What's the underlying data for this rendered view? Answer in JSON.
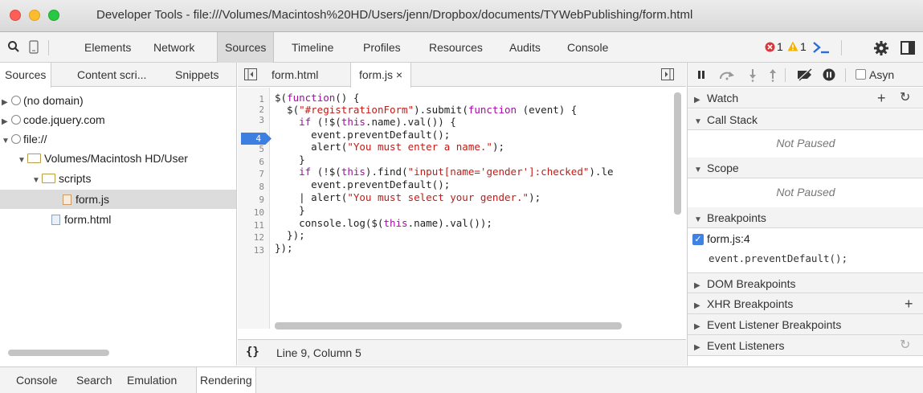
{
  "window": {
    "title": "Developer Tools - file:///Volumes/Macintosh%20HD/Users/jenn/Dropbox/documents/TYWebPublishing/form.html"
  },
  "toolbar": {
    "tabs": [
      "Elements",
      "Network",
      "Sources",
      "Timeline",
      "Profiles",
      "Resources",
      "Audits",
      "Console"
    ],
    "selected_tab": "Sources",
    "error_count": "1",
    "warning_count": "1"
  },
  "navigator": {
    "tabs": [
      "Sources",
      "Content scri...",
      "Snippets"
    ],
    "tree": [
      {
        "label": "(no domain)"
      },
      {
        "label": "code.jquery.com"
      },
      {
        "label": "file://"
      },
      {
        "label": "Volumes/Macintosh HD/User"
      },
      {
        "label": "scripts"
      },
      {
        "label": "form.js"
      },
      {
        "label": "form.html"
      }
    ]
  },
  "editor": {
    "tabs": [
      {
        "label": "form.html"
      },
      {
        "label": "form.js"
      }
    ],
    "close_glyph": "×",
    "line_numbers": [
      "1",
      "2",
      "3",
      "4",
      "5",
      "6",
      "7",
      "8",
      "9",
      "10",
      "11",
      "12",
      "13"
    ],
    "breakpoint_line": "4",
    "status": "Line 9, Column 5",
    "format_glyph": "{}"
  },
  "sidebar": {
    "async_label": "Asyn",
    "panes": {
      "watch": "Watch",
      "call_stack": "Call Stack",
      "call_stack_status": "Not Paused",
      "scope": "Scope",
      "scope_status": "Not Paused",
      "breakpoints": "Breakpoints",
      "breakpoint_file": "form.js:4",
      "breakpoint_code": "event.preventDefault();",
      "dom_breakpoints": "DOM Breakpoints",
      "xhr_breakpoints": "XHR Breakpoints",
      "event_listener_breakpoints": "Event Listener Breakpoints",
      "event_listeners": "Event Listeners"
    }
  },
  "drawer": {
    "tabs": [
      "Console",
      "Search",
      "Emulation",
      "Rendering"
    ],
    "selected_tab": "Rendering"
  },
  "colors": {
    "close_light": "#fc5f57",
    "minimize_light": "#fdbc2e",
    "zoom_light": "#28c840",
    "breakpoint_marker": "#3d7fe0",
    "keyword": "#a50aa5",
    "string": "#c41a16"
  },
  "icons": [
    "search-icon",
    "device-mode-icon",
    "error-icon",
    "warning-icon",
    "console-prompt-icon",
    "gear-icon",
    "dock-icon",
    "toggle-navigator-icon",
    "toggle-debugger-icon",
    "pause-icon",
    "step-over-icon",
    "step-into-icon",
    "step-out-icon",
    "deactivate-breakpoints-icon",
    "pause-on-exceptions-icon",
    "add-icon",
    "refresh-icon"
  ]
}
